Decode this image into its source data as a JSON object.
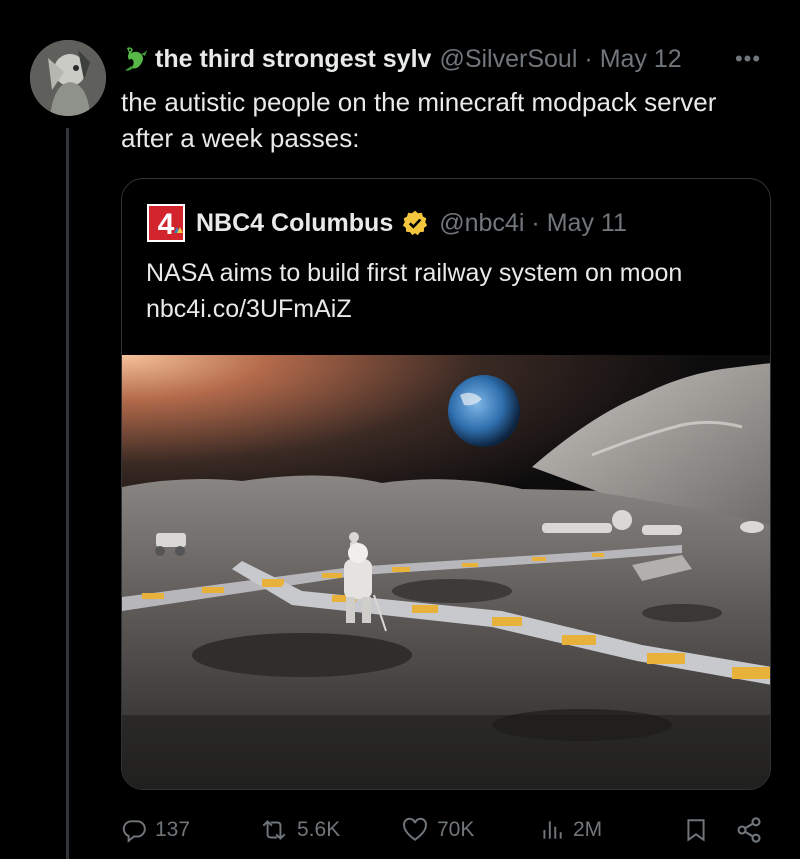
{
  "tweet": {
    "author_name": "the third strongest sylv",
    "author_handle": "@SilverSoul",
    "separator": "·",
    "date": "May 12",
    "more_label": "•••",
    "text": "the autistic people on the minecraft modpack server after a week passes:"
  },
  "quoted_tweet": {
    "author_name": "NBC4 Columbus",
    "author_handle": "@nbc4i",
    "separator": "·",
    "date": "May 11",
    "text": "NASA aims to build first railway system on moon",
    "link": "nbc4i.co/3UFmAiZ",
    "logo_text": "4",
    "verified_color": "#f4c63d"
  },
  "actions": {
    "replies": "137",
    "reposts": "5.6K",
    "likes": "70K",
    "views": "2M"
  },
  "icons": [
    "dragon-emoji-icon",
    "nbc-logo-icon",
    "verified-badge-icon",
    "reply-icon",
    "repost-icon",
    "like-icon",
    "views-icon",
    "bookmark-icon",
    "share-icon",
    "more-icon"
  ],
  "colors": {
    "background": "#000000",
    "text": "#e7e9ea",
    "secondary": "#71767b",
    "border": "#2f3336"
  }
}
